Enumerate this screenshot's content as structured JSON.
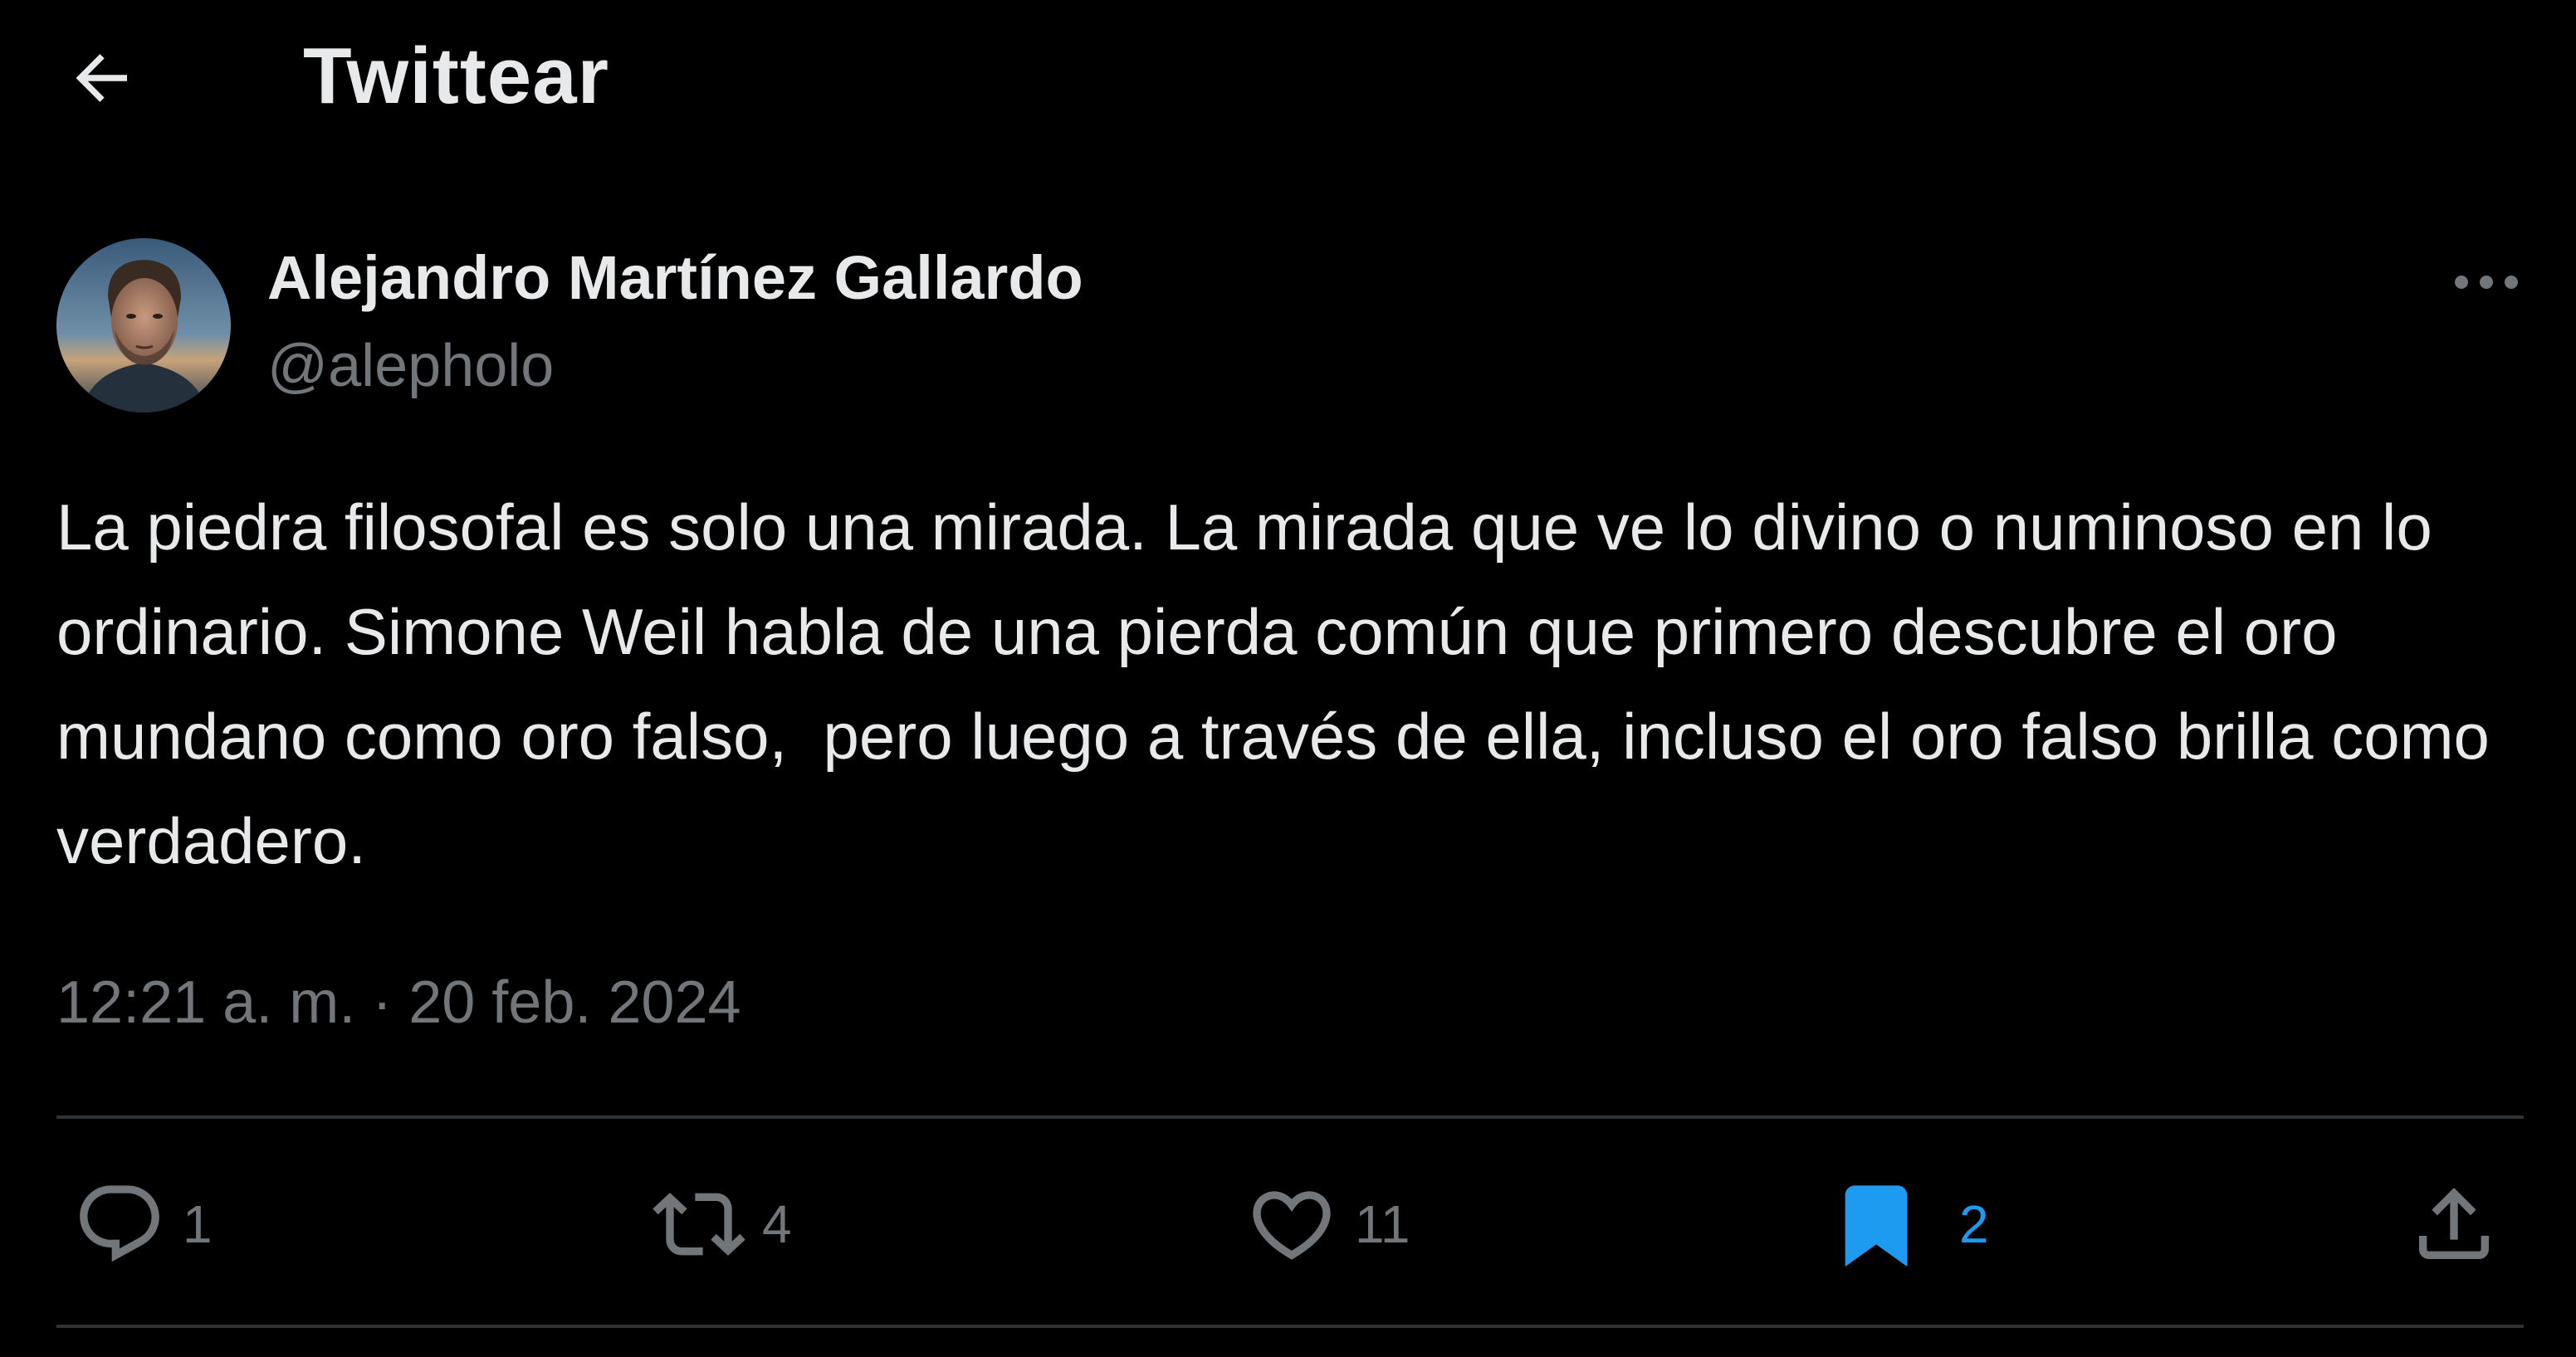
{
  "colors": {
    "background": "#000000",
    "text_primary": "#e7e9ea",
    "text_secondary": "#71767b",
    "accent": "#1d9bf0",
    "divider": "#2f3336"
  },
  "header": {
    "back_icon": "arrow-left-icon",
    "title": "Twittear"
  },
  "author": {
    "display_name": "Alejandro Martínez Gallardo",
    "handle": "@alepholo",
    "avatar": "profile-photo",
    "more_icon": "more-horizontal-icon"
  },
  "tweet": {
    "text": "La piedra filosofal es solo una mirada. La mirada que ve lo divino o numinoso en lo ordinario. Simone Weil habla de una pierda común que primero descubre el oro mundano como oro falso,  pero luego a través de ella, incluso el oro falso brilla como verdadero.",
    "time": "12:21 a. m.",
    "separator": " · ",
    "date": "20 feb. 2024"
  },
  "actions": {
    "reply": {
      "icon": "reply-icon",
      "count": "1"
    },
    "retweet": {
      "icon": "retweet-icon",
      "count": "4"
    },
    "like": {
      "icon": "heart-icon",
      "count": "11"
    },
    "bookmark": {
      "icon": "bookmark-filled-icon",
      "count": "2",
      "active": true
    },
    "share": {
      "icon": "share-icon"
    }
  }
}
